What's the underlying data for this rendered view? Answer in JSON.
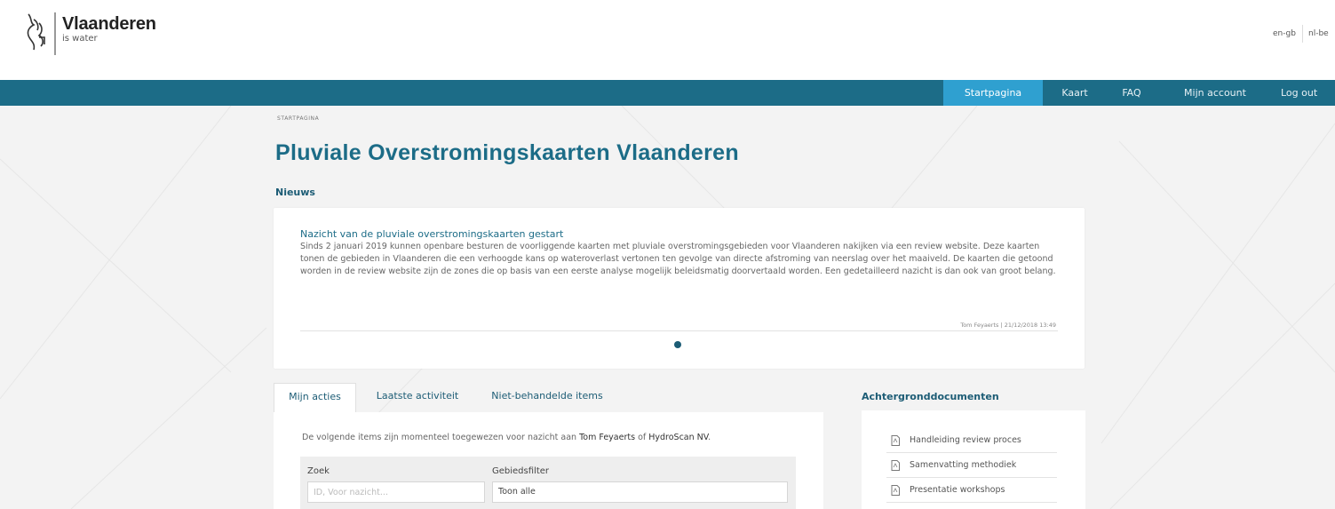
{
  "brand": {
    "title": "Vlaanderen",
    "subtitle": "is water"
  },
  "languages": [
    "en-gb",
    "nl-be"
  ],
  "nav": {
    "items": [
      "Startpagina",
      "Kaart",
      "FAQ",
      "Mijn account",
      "Log out"
    ],
    "active": "Startpagina"
  },
  "breadcrumb": "STARTPAGINA",
  "page_title": "Pluviale Overstromingskaarten Vlaanderen",
  "news": {
    "heading": "Nieuws",
    "item": {
      "title": "Nazicht van de pluviale overstromingskaarten gestart",
      "body": "Sinds 2 januari 2019 kunnen openbare besturen de voorliggende kaarten met pluviale overstromingsgebieden voor Vlaanderen nakijken via een review website. Deze kaarten tonen de gebieden in Vlaanderen die een verhoogde kans op wateroverlast vertonen ten gevolge van directe afstroming van neerslag over het maaiveld. De kaarten die getoond worden in de review website zijn de zones die op basis van een eerste analyse mogelijk beleidsmatig doorvertaald worden. Een gedetailleerd nazicht is dan ook van groot belang.",
      "meta": "Tom Feyaerts | 21/12/2018 13:49"
    }
  },
  "tabs": {
    "items": [
      "Mijn acties",
      "Laatste activiteit",
      "Niet-behandelde items"
    ],
    "active": "Mijn acties"
  },
  "my_actions": {
    "text_before": "De volgende items zijn momenteel toegewezen voor nazicht aan ",
    "user": "Tom Feyaerts",
    "text_middle": " of ",
    "company": "HydroScan NV",
    "text_after": ".",
    "search_label": "Zoek",
    "search_placeholder": "ID, Voor nazicht...",
    "area_filter_label": "Gebiedsfilter",
    "area_filter_value": "Toon alle"
  },
  "documents": {
    "heading": "Achtergronddocumenten",
    "items": [
      "Handleiding review proces",
      "Samenvatting methodiek",
      "Presentatie workshops"
    ]
  },
  "colors": {
    "nav_bg": "#1c6c87",
    "nav_active": "#2fa0d0",
    "title": "#1c6c87",
    "page_bg": "#f3f3f3"
  }
}
